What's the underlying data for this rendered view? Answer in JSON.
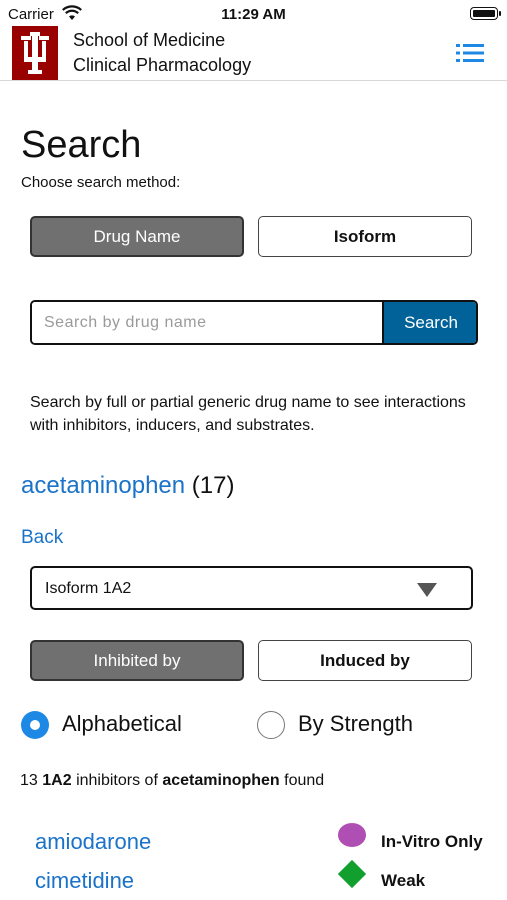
{
  "status_bar": {
    "carrier": "Carrier",
    "time": "11:29 AM"
  },
  "header": {
    "org_line1": "School of Medicine",
    "org_line2": "Clinical Pharmacology",
    "logo_color": "#990000"
  },
  "page": {
    "title": "Search",
    "subtitle": "Choose search method:"
  },
  "method_buttons": {
    "drug_name": "Drug Name",
    "isoform": "Isoform",
    "selected": "Drug Name"
  },
  "search": {
    "placeholder": "Search by drug name",
    "button_label": "Search",
    "button_color": "#006298"
  },
  "help_text": "Search by full or partial generic drug name to see interactions with inhibitors, inducers, and substrates.",
  "drug": {
    "name": "acetaminophen",
    "count": "(17)"
  },
  "back_label": "Back",
  "isoform_select": {
    "value": "Isoform 1A2"
  },
  "relation_buttons": {
    "inhibited_by": "Inhibited by",
    "induced_by": "Induced by",
    "selected": "Inhibited by"
  },
  "sort": {
    "alphabetical": "Alphabetical",
    "by_strength": "By Strength",
    "selected": "Alphabetical"
  },
  "summary": {
    "count": "13",
    "isoform": "1A2",
    "mid": "inhibitors of",
    "drug": "acetaminophen",
    "end": "found"
  },
  "results": [
    {
      "name": "amiodarone"
    },
    {
      "name": "cimetidine"
    }
  ],
  "legend": [
    {
      "label": "In-Vitro Only",
      "shape": "oval",
      "color": "#b04fb3"
    },
    {
      "label": "Weak",
      "shape": "diamond",
      "color": "#11a02e"
    }
  ],
  "link_color": "#1a73c9"
}
